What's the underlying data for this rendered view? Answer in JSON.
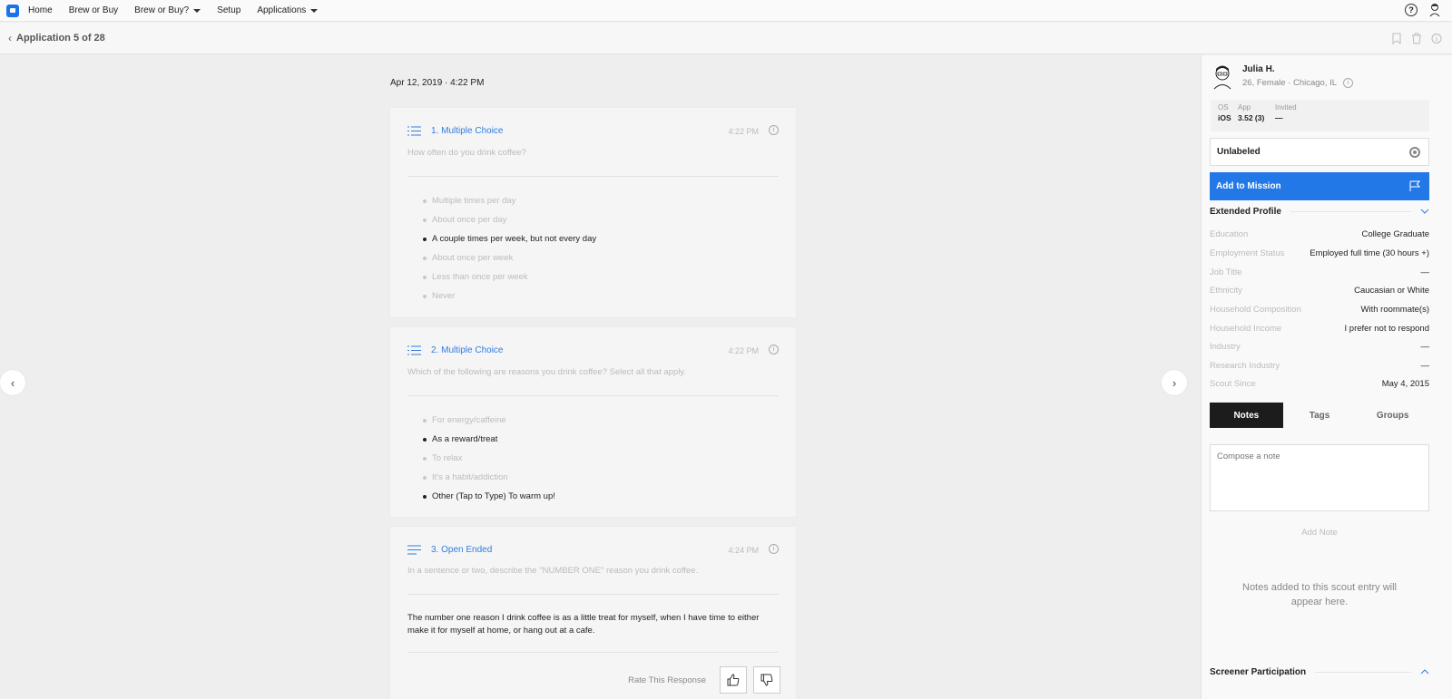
{
  "nav": {
    "items": [
      {
        "label": "Home",
        "dropdown": false
      },
      {
        "label": "Brew or Buy",
        "dropdown": false
      },
      {
        "label": "Brew or Buy?",
        "dropdown": true
      },
      {
        "label": "Setup",
        "dropdown": false
      },
      {
        "label": "Applications",
        "dropdown": true
      }
    ],
    "help_glyph": "?",
    "accent": "#1a73e8"
  },
  "subheader": {
    "title": "Application 5 of 28",
    "icons": [
      "bookmark-icon",
      "trash-icon",
      "info-icon"
    ]
  },
  "main": {
    "date": "Apr 12, 2019 · 4:22 PM",
    "questions": [
      {
        "type_label": "1. Multiple Choice",
        "time": "4:22 PM",
        "question": "How often do you drink coffee?",
        "options": [
          {
            "text": "Multiple times per day",
            "selected": false
          },
          {
            "text": "About once per day",
            "selected": false
          },
          {
            "text": "A couple times per week, but not every day",
            "selected": true
          },
          {
            "text": "About once per week",
            "selected": false
          },
          {
            "text": "Less than once per week",
            "selected": false
          },
          {
            "text": "Never",
            "selected": false
          }
        ]
      },
      {
        "type_label": "2. Multiple Choice",
        "time": "4:22 PM",
        "question": "Which of the following are reasons you drink coffee? Select all that apply.",
        "options": [
          {
            "text": "For energy/caffeine",
            "selected": false
          },
          {
            "text": "As a reward/treat",
            "selected": true
          },
          {
            "text": "To relax",
            "selected": false
          },
          {
            "text": "It's a habit/addiction",
            "selected": false
          },
          {
            "text": "Other (Tap to Type) To warm up!",
            "selected": true
          }
        ]
      },
      {
        "type_label": "3. Open Ended",
        "time": "4:24 PM",
        "question": "In a sentence or two, describe the \"NUMBER ONE\" reason you drink coffee.",
        "answer": "The number one reason I drink coffee is as a little treat for myself, when I have time to either make it for myself at home, or hang out at a cafe.",
        "rate_label": "Rate This Response"
      }
    ]
  },
  "profile": {
    "name": "Julia H.",
    "details": "26, Female · Chicago, IL",
    "os_label": "OS",
    "os_value": "iOS",
    "app_label": "App",
    "app_value": "3.52 (3)",
    "invited_label": "Invited",
    "invited_value": "—",
    "label_value": "Unlabeled",
    "mission_button": "Add to Mission",
    "mission_color": "#2378e8"
  },
  "extended": {
    "title": "Extended Profile",
    "rows": [
      {
        "key": "Education",
        "value": "College Graduate"
      },
      {
        "key": "Employment Status",
        "value": "Employed full time (30 hours +)"
      },
      {
        "key": "Job Title",
        "value": "—"
      },
      {
        "key": "Ethnicity",
        "value": "Caucasian or White"
      },
      {
        "key": "Household Composition",
        "value": "With roommate(s)"
      },
      {
        "key": "Household Income",
        "value": "I prefer not to respond"
      },
      {
        "key": "Industry",
        "value": "—"
      },
      {
        "key": "Research Industry",
        "value": "—"
      },
      {
        "key": "Scout Since",
        "value": "May 4, 2015"
      }
    ]
  },
  "tabs": [
    "Notes",
    "Tags",
    "Groups"
  ],
  "active_tab": "Notes",
  "notes": {
    "placeholder": "Compose a note",
    "add_label": "Add Note",
    "empty_text": "Notes added to this scout entry will appear here."
  },
  "screener": {
    "title": "Screener Participation"
  }
}
